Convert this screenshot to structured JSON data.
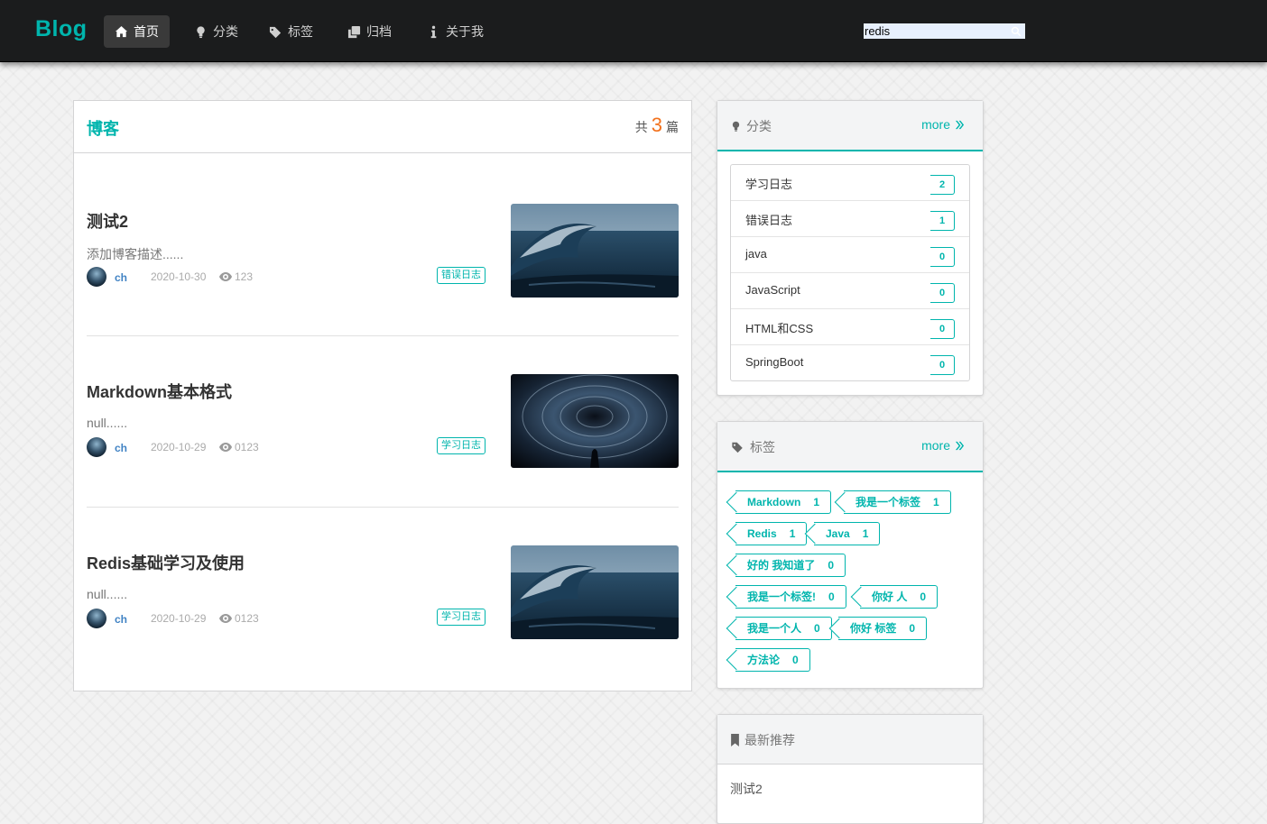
{
  "nav": {
    "brand": "Blog",
    "items": [
      {
        "label": "首页",
        "icon": "home-icon"
      },
      {
        "label": "分类",
        "icon": "lightbulb-icon"
      },
      {
        "label": "标签",
        "icon": "tags-icon"
      },
      {
        "label": "归档",
        "icon": "clone-icon"
      },
      {
        "label": "关于我",
        "icon": "info-icon"
      }
    ],
    "active_index": 0,
    "search": {
      "value": "redis",
      "icon": "search-icon"
    }
  },
  "blog": {
    "title": "博客",
    "count_prefix": "共",
    "count": "3",
    "count_suffix": "篇",
    "posts": [
      {
        "title": "测试2",
        "desc": "添加博客描述......",
        "author": "ch",
        "date": "2020-10-30",
        "views": "123",
        "tag": "错误日志",
        "image": "ocean-wave-image"
      },
      {
        "title": "Markdown基本格式",
        "desc": "null......",
        "author": "ch",
        "date": "2020-10-29",
        "views": "0123",
        "tag": "学习日志",
        "image": "vortex-image"
      },
      {
        "title": "Redis基础学习及使用",
        "desc": "null......",
        "author": "ch",
        "date": "2020-10-29",
        "views": "0123",
        "tag": "学习日志",
        "image": "ocean-wave-image"
      }
    ]
  },
  "categories": {
    "title": "分类",
    "more": "more",
    "items": [
      {
        "name": "学习日志",
        "count": "2"
      },
      {
        "name": "错误日志",
        "count": "1"
      },
      {
        "name": "java",
        "count": "0"
      },
      {
        "name": "JavaScript",
        "count": "0"
      },
      {
        "name": "HTML和CSS",
        "count": "0"
      },
      {
        "name": "SpringBoot",
        "count": "0"
      }
    ]
  },
  "tags": {
    "title": "标签",
    "more": "more",
    "items": [
      {
        "name": "Markdown",
        "count": "1"
      },
      {
        "name": "我是一个标签",
        "count": "1"
      },
      {
        "name": "Redis",
        "count": "1"
      },
      {
        "name": "Java",
        "count": "1"
      },
      {
        "name": "好的 我知道了",
        "count": "0"
      },
      {
        "name": "我是一个标签!",
        "count": "0"
      },
      {
        "name": "你好 人",
        "count": "0"
      },
      {
        "name": "我是一个人",
        "count": "0"
      },
      {
        "name": "你好 标签",
        "count": "0"
      },
      {
        "name": "方法论",
        "count": "0"
      }
    ]
  },
  "recommend": {
    "title": "最新推荐",
    "items": [
      "测试2"
    ]
  },
  "colors": {
    "accent": "#00b5ad",
    "count_number": "#f2711c",
    "navbar": "#1b1c1d"
  }
}
